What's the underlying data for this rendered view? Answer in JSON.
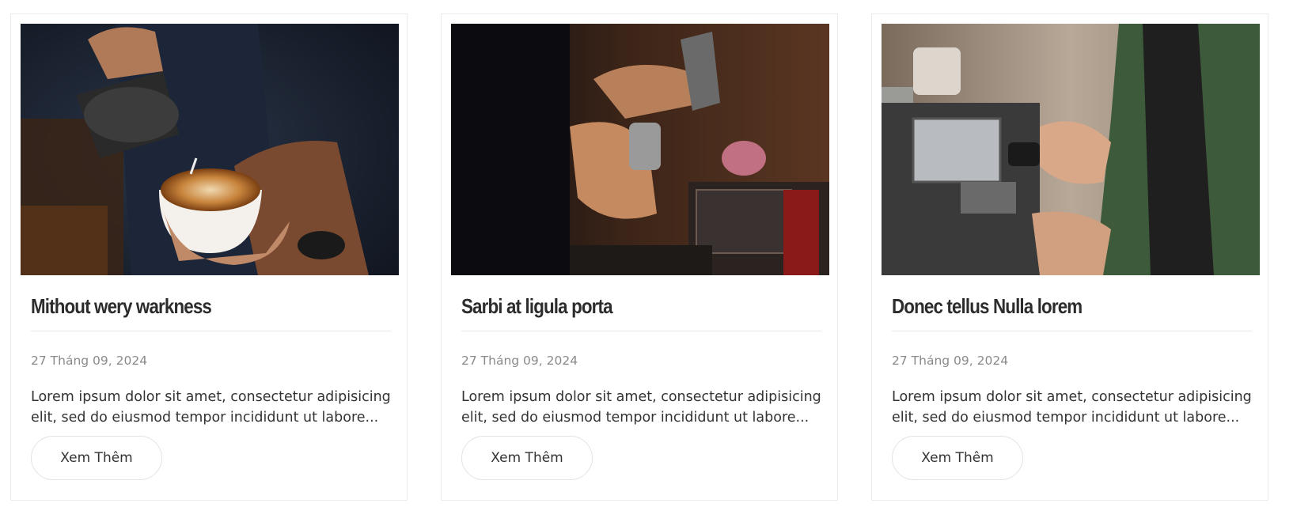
{
  "posts": [
    {
      "title": "Mithout wery warkness",
      "date": "27 Tháng 09, 2024",
      "excerpt": "Lorem ipsum dolor sit amet, consectetur adipisicing elit, sed do eiusmod tempor incididunt ut labore...",
      "button_label": "Xem Thêm"
    },
    {
      "title": "Sarbi at ligula porta",
      "date": "27 Tháng 09, 2024",
      "excerpt": "Lorem ipsum dolor sit amet, consectetur adipisicing elit, sed do eiusmod tempor incididunt ut labore...",
      "button_label": "Xem Thêm"
    },
    {
      "title": "Donec tellus Nulla lorem",
      "date": "27 Tháng 09, 2024",
      "excerpt": "Lorem ipsum dolor sit amet, consectetur adipisicing elit, sed do eiusmod tempor incididunt ut labore...",
      "button_label": "Xem Thêm"
    }
  ]
}
